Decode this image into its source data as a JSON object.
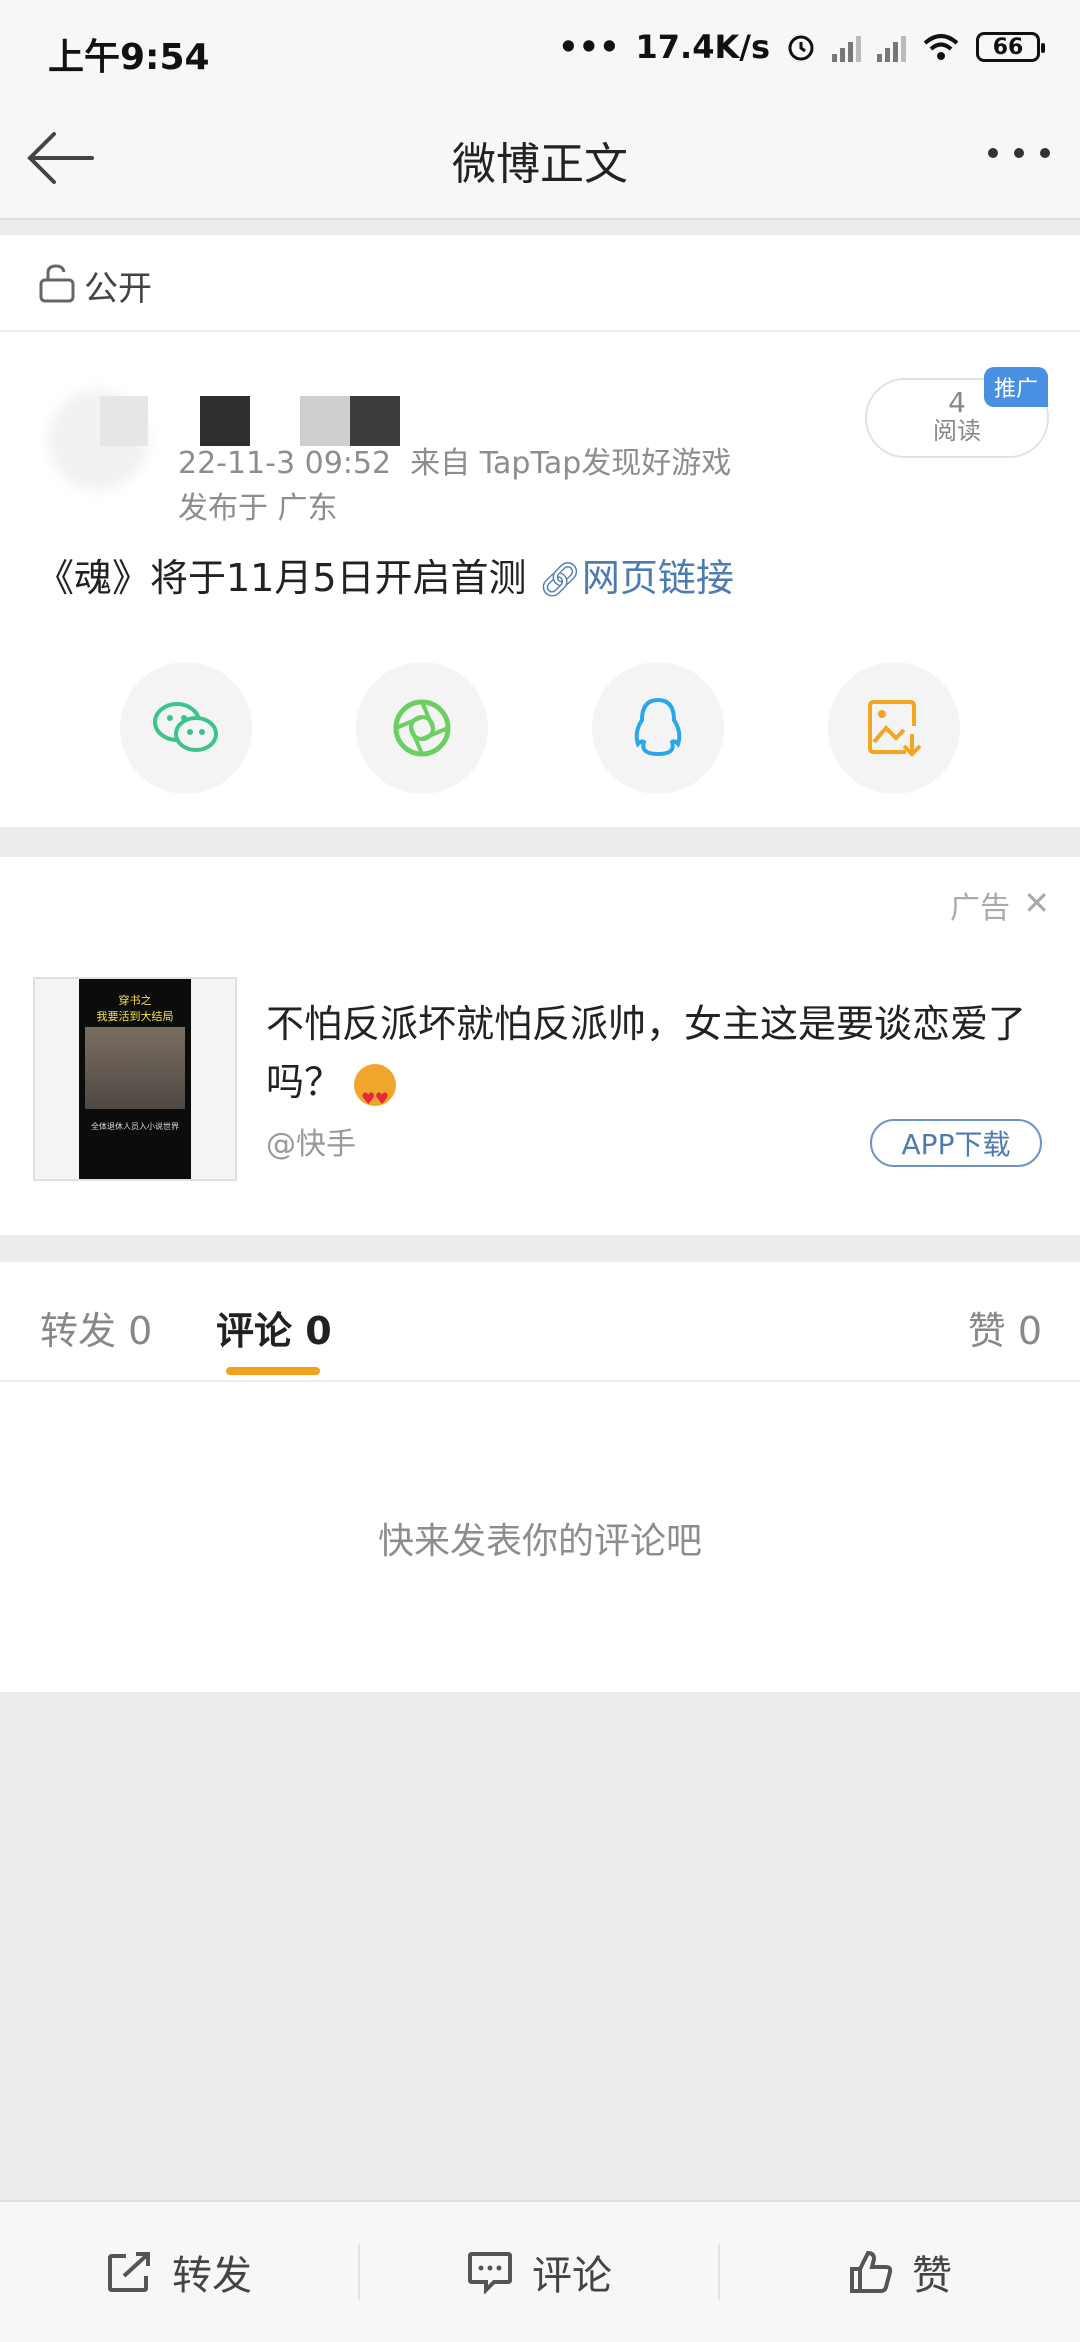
{
  "status_bar": {
    "time": "上午9:54",
    "network_speed": "17.4K/s",
    "battery": "66",
    "icons": [
      "more-dots-icon",
      "alarm-icon",
      "signal-icon",
      "signal-icon",
      "wifi-icon",
      "battery-icon"
    ]
  },
  "nav": {
    "title": "微博正文",
    "back_icon": "back-arrow-icon",
    "more_icon": "more-icon"
  },
  "post": {
    "visibility": "公开",
    "timestamp": "22-11-3 09:52",
    "source": "来自 TapTap发现好游戏",
    "location": "发布于 广东",
    "read_count": "4",
    "read_label": "阅读",
    "promo_tag": "推广",
    "text": "《魂》将于11月5日开启首测",
    "link_text": "网页链接",
    "share_buttons": [
      "wechat-icon",
      "moments-icon",
      "qq-icon",
      "save-image-icon"
    ]
  },
  "ad": {
    "label": "广告",
    "title": "不怕反派坏就怕反派帅，女主这是要谈恋爱了吗？",
    "source": "@快手",
    "cta": "APP下载",
    "thumb_title_line1": "穿书之",
    "thumb_title_line2": "我要活到大结局",
    "thumb_sub": "全体退休人员入小说世界"
  },
  "tabs": {
    "repost": "转发 0",
    "comment": "评论 0",
    "like": "赞 0",
    "active": "comment"
  },
  "empty_hint": "快来发表你的评论吧",
  "bottom_bar": {
    "repost": "转发",
    "comment": "评论",
    "like": "赞"
  },
  "colors": {
    "accent": "#f0a31a",
    "link": "#4e7bb0",
    "wechat": "#3cc48c",
    "moments": "#6ccf62",
    "qq": "#2aa7e8",
    "save": "#f2a623",
    "promo": "#4a90e2"
  }
}
